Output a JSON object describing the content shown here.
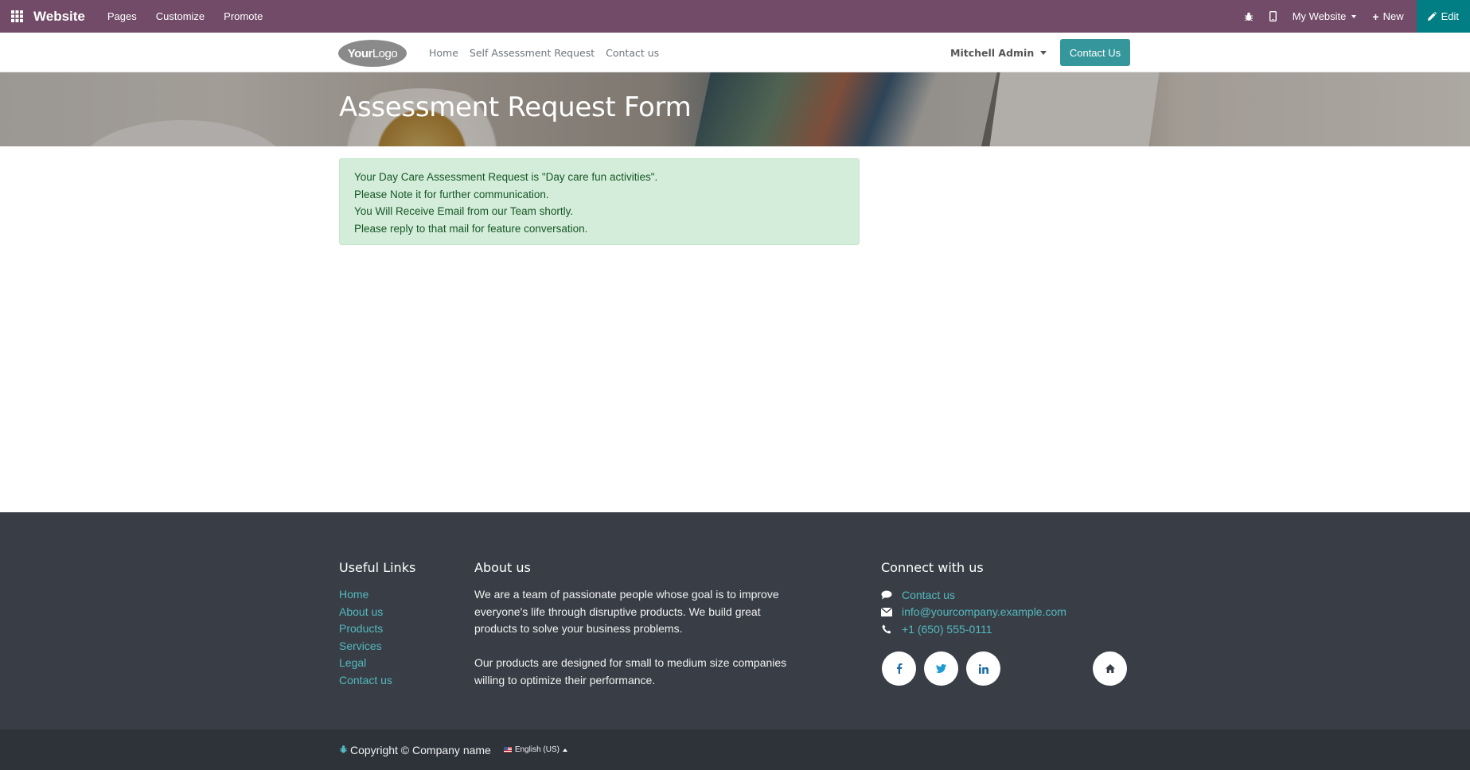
{
  "adminbar": {
    "brand": "Website",
    "menu": [
      "Pages",
      "Customize",
      "Promote"
    ],
    "my_website": "My Website",
    "new_label": "New",
    "edit_label": "Edit",
    "bg_color": "#714B67",
    "edit_color": "#017E84"
  },
  "header": {
    "logo_text_bold": "Your",
    "logo_text": "Logo",
    "nav": [
      "Home",
      "Self Assessment Request",
      "Contact us"
    ],
    "user": "Mitchell Admin",
    "contact_button": "Contact Us",
    "accent": "#35979c"
  },
  "banner": {
    "title": "Assessment Request Form"
  },
  "alert": {
    "lines": [
      "Your Day Care Assessment Request is \"Day care fun activities\".",
      "Please Note it for further communication.",
      "You Will Receive Email from our Team shortly.",
      "Please reply to that mail for feature conversation."
    ],
    "bg_color": "#d4edda",
    "text_color": "#155724"
  },
  "footer": {
    "useful_links": {
      "title": "Useful Links",
      "links": [
        "Home",
        "About us",
        "Products",
        "Services",
        "Legal",
        "Contact us"
      ]
    },
    "about": {
      "title": "About us",
      "p1": "We are a team of passionate people whose goal is to improve everyone's life through disruptive products. We build great products to solve your business problems.",
      "p2": "Our products are designed for small to medium size companies willing to optimize their performance."
    },
    "connect": {
      "title": "Connect with us",
      "contact": "Contact us",
      "email": "info@yourcompany.example.com",
      "phone": "+1 (650) 555-0111"
    },
    "social_icons": [
      "facebook-icon",
      "twitter-icon",
      "linkedin-icon",
      "home-icon"
    ],
    "bg_color": "#393e46"
  },
  "copyright": {
    "text": "Copyright © Company name",
    "language": "English (US)"
  }
}
